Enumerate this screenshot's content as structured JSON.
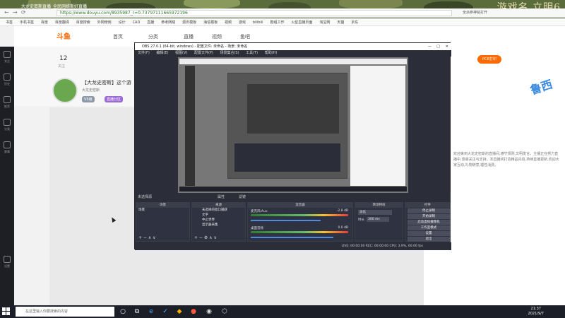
{
  "browser": {
    "tab_title": "大龙史密斯直播_全民网络斯好直播",
    "url": "https://www.douyu.com/8935987_r=0.73797111665972196",
    "watermark": "游戏名.立明6",
    "nav_buttons": [
      "←",
      "→",
      "⟳"
    ],
    "bookmarks": [
      "书签",
      "手机书签",
      "百度",
      "百度翻译",
      "百度搜索",
      "外网使用",
      "设计",
      "CAD",
      "直播",
      "参考网络",
      "源页模板",
      "海信模板",
      "视频",
      "游戏",
      "bilibili",
      "剧组工作",
      "火星直播页面",
      "淘宝网",
      "天猫",
      "京东"
    ],
    "right_action": "全派参神铭打开"
  },
  "douyu": {
    "logo": "斗鱼",
    "nav": [
      "首页",
      "分类",
      "直播",
      "视频",
      "鱼吧"
    ],
    "left_nav": [
      "关注",
      "历史",
      "推荐",
      "分类",
      "赛事",
      "星推",
      "娱乐",
      "设置"
    ],
    "stats_value": "12",
    "stats_label": "关注",
    "streamer_title": "【大龙史密斯】这个游",
    "streamer_sub": "大龙史密斯",
    "tags": [
      "V5级",
      "直播分区"
    ],
    "pcb_badge": "PCB打印",
    "side_logo": "鲁西",
    "chat_text": "欢迎来到大龙史密斯的直播间,遵守规则,文明发言。主播正在努力直播中,感谢关注与支持。本直播间打造精品内容,持续直播更新,欢迎大家互动,礼物随意,理性消费。"
  },
  "obs": {
    "title": "OBS 27.0.1 (64-bit, windows) - 配置文件: 未命名 - 场景: 未命名",
    "win_controls": [
      "—",
      "□",
      "✕"
    ],
    "menu": [
      "文件(F)",
      "编辑(E)",
      "视图(V)",
      "配置文件(P)",
      "场景集合(S)",
      "工具(T)",
      "帮助(H)"
    ],
    "status_left": "未选择源",
    "status_props": "属性",
    "status_filters": "滤镜",
    "docks": {
      "scenes": {
        "header": "场景",
        "items": [
          "场景"
        ]
      },
      "sources": {
        "header": "来源",
        "items": [
          "未选择的窗口捕获",
          "文字",
          "中止世界",
          "显示器采集"
        ]
      },
      "mixer": {
        "header": "混音器",
        "ch1": "麦克风/Aux",
        "ch1_db": "-2.8 dB",
        "ch2": "桌面音频",
        "ch2_db": "0.0 dB",
        "ch1_level": 0.72,
        "ch2_level": 0.85
      },
      "transitions": {
        "header": "转场特效",
        "type": "淡化",
        "duration_label": "时长",
        "duration": "300 ms"
      },
      "controls": {
        "header": "控件",
        "buttons": [
          "停止录制",
          "开始录制",
          "启动虚拟摄像机",
          "工作室模式",
          "设置",
          "退出"
        ]
      }
    },
    "bottom_status": "LIVE: 00:00:00   REC: 00:00:00   CPU: 3.9%, 60.00 fps"
  },
  "taskbar": {
    "search_placeholder": "在这里输入你要搜索的内容",
    "time": "21:37",
    "date": "2021/9/7",
    "icons": [
      "○",
      "⧉",
      "e",
      "✓",
      "◆",
      "●",
      "◉",
      "⬡"
    ]
  }
}
